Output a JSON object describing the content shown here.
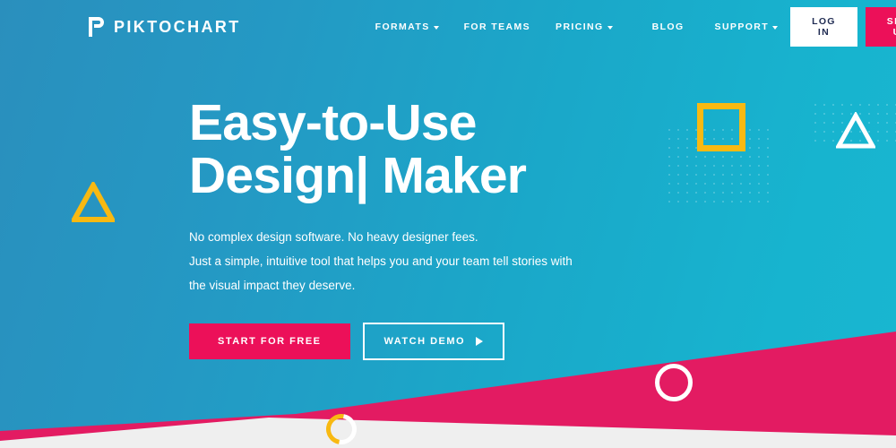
{
  "brand": {
    "logo_text": "PIKTOCHART",
    "logo_icon": "piktochart-p-mark-icon",
    "accent_pink": "#ec1059",
    "accent_yellow": "#f8b912",
    "bg_blue_left": "#2a8fbd",
    "bg_cyan_right": "#19b6d0",
    "band_light": "#efefef"
  },
  "nav": {
    "items": [
      {
        "label": "FORMATS",
        "has_caret": true
      },
      {
        "label": "FOR TEAMS",
        "has_caret": false
      },
      {
        "label": "PRICING",
        "has_caret": true
      },
      {
        "label": "BLOG",
        "has_caret": false
      },
      {
        "label": "SUPPORT",
        "has_caret": true
      }
    ],
    "login_label": "LOG IN",
    "signup_label": "SIGN UP"
  },
  "hero": {
    "headline_line1": "Easy-to-Use",
    "headline_line2": "Design| Maker",
    "subtext_line1": "No complex design software. No heavy designer fees.",
    "subtext_line2": "Just a simple, intuitive tool that helps you and your team tell stories with",
    "subtext_line3": "the visual impact they deserve.",
    "primary_cta": "START FOR FREE",
    "secondary_cta": "WATCH DEMO"
  },
  "decorations": [
    {
      "name": "yellow-square-outline",
      "color": "#f8b912"
    },
    {
      "name": "yellow-triangle-outline",
      "color": "#f8b912"
    },
    {
      "name": "white-triangle-outline",
      "color": "#ffffff"
    },
    {
      "name": "white-circle-outline",
      "color": "#ffffff"
    },
    {
      "name": "yellow-white-circle-outline",
      "color": "#f8b912"
    },
    {
      "name": "dot-grid-pattern",
      "color": "rgba(255,255,255,0.20)"
    }
  ]
}
